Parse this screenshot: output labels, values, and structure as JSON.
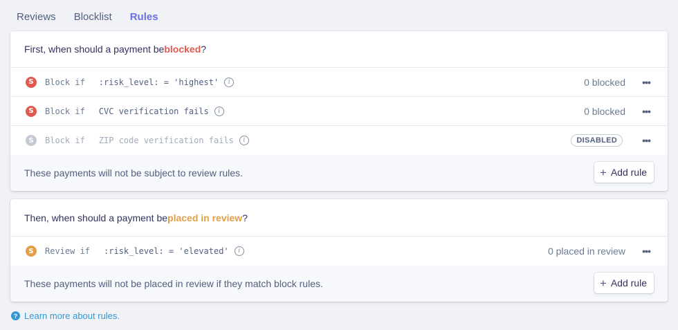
{
  "tabs": [
    {
      "label": "Reviews"
    },
    {
      "label": "Blocklist"
    },
    {
      "label": "Rules"
    }
  ],
  "block_section": {
    "title_prefix": "First, when should a payment be ",
    "title_highlight": "blocked",
    "title_suffix": "?",
    "highlight_color": "#e25950",
    "rules": [
      {
        "badge": "S",
        "verb": "Block if",
        "condition": ":risk_level: = 'highest'",
        "count": "0 blocked",
        "status": "enabled"
      },
      {
        "badge": "S",
        "verb": "Block if",
        "condition": "CVC verification fails",
        "count": "0 blocked",
        "status": "enabled"
      },
      {
        "badge": "S",
        "verb": "Block if",
        "condition": "ZIP code verification fails",
        "status_label": "DISABLED",
        "status": "disabled"
      }
    ],
    "footer_text": "These payments will not be subject to review rules.",
    "add_label": "Add rule"
  },
  "review_section": {
    "title_prefix": "Then, when should a payment be ",
    "title_highlight": "placed in review",
    "title_suffix": "?",
    "highlight_color": "#e39f48",
    "rules": [
      {
        "badge": "S",
        "verb": "Review if",
        "condition": ":risk_level: = 'elevated'",
        "count": "0 placed in review",
        "status": "enabled"
      }
    ],
    "footer_text": "These payments will not be placed in review if they match block rules.",
    "add_label": "Add rule"
  },
  "learn_more": "Learn more about rules.",
  "icons": {
    "info": "info-icon",
    "more": "more-horizontal-icon",
    "plus": "plus-icon",
    "help": "help-circle-icon"
  },
  "colors": {
    "accent": "#6772e5",
    "link": "#3297d3",
    "background": "#f1f2f6"
  }
}
